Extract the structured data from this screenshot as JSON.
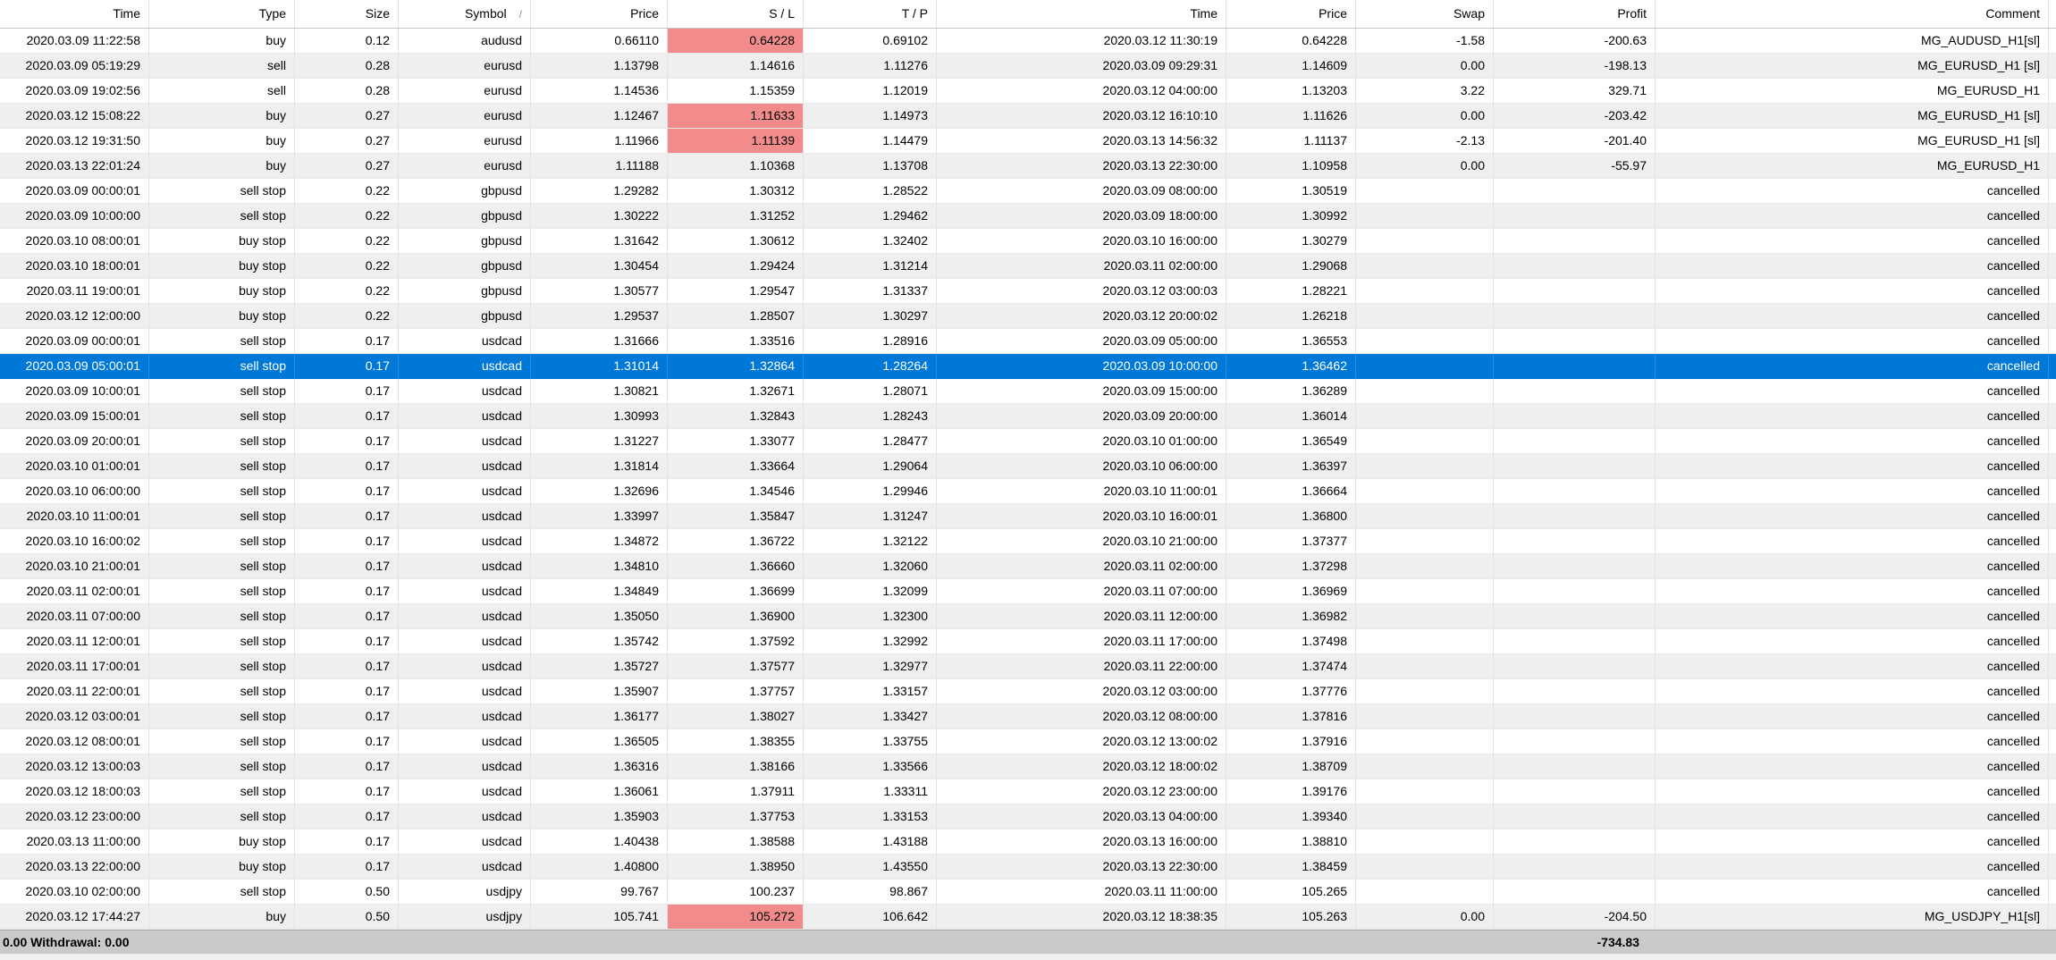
{
  "table": {
    "columns": [
      {
        "key": "time",
        "label": "Time"
      },
      {
        "key": "type",
        "label": "Type"
      },
      {
        "key": "size",
        "label": "Size"
      },
      {
        "key": "symbol",
        "label": "Symbol",
        "sort_icon": "/"
      },
      {
        "key": "price",
        "label": "Price"
      },
      {
        "key": "sl",
        "label": "S / L"
      },
      {
        "key": "tp",
        "label": "T / P"
      },
      {
        "key": "ctime",
        "label": "Time"
      },
      {
        "key": "cprice",
        "label": "Price"
      },
      {
        "key": "swap",
        "label": "Swap"
      },
      {
        "key": "profit",
        "label": "Profit"
      },
      {
        "key": "comment",
        "label": "Comment"
      }
    ],
    "rows": [
      {
        "time": "2020.03.09 11:22:58",
        "type": "buy",
        "size": "0.12",
        "symbol": "audusd",
        "price": "0.66110",
        "sl": "0.64228",
        "sl_hit": true,
        "tp": "0.69102",
        "ctime": "2020.03.12 11:30:19",
        "cprice": "0.64228",
        "swap": "-1.58",
        "profit": "-200.63",
        "comment": "MG_AUDUSD_H1[sl]"
      },
      {
        "time": "2020.03.09 05:19:29",
        "type": "sell",
        "size": "0.28",
        "symbol": "eurusd",
        "price": "1.13798",
        "sl": "1.14616",
        "tp": "1.11276",
        "ctime": "2020.03.09 09:29:31",
        "cprice": "1.14609",
        "swap": "0.00",
        "profit": "-198.13",
        "comment": "MG_EURUSD_H1 [sl]"
      },
      {
        "time": "2020.03.09 19:02:56",
        "type": "sell",
        "size": "0.28",
        "symbol": "eurusd",
        "price": "1.14536",
        "sl": "1.15359",
        "tp": "1.12019",
        "ctime": "2020.03.12 04:00:00",
        "cprice": "1.13203",
        "swap": "3.22",
        "profit": "329.71",
        "comment": "MG_EURUSD_H1"
      },
      {
        "time": "2020.03.12 15:08:22",
        "type": "buy",
        "size": "0.27",
        "symbol": "eurusd",
        "price": "1.12467",
        "sl": "1.11633",
        "sl_hit": true,
        "tp": "1.14973",
        "ctime": "2020.03.12 16:10:10",
        "cprice": "1.11626",
        "swap": "0.00",
        "profit": "-203.42",
        "comment": "MG_EURUSD_H1 [sl]"
      },
      {
        "time": "2020.03.12 19:31:50",
        "type": "buy",
        "size": "0.27",
        "symbol": "eurusd",
        "price": "1.11966",
        "sl": "1.11139",
        "sl_hit": true,
        "tp": "1.14479",
        "ctime": "2020.03.13 14:56:32",
        "cprice": "1.11137",
        "swap": "-2.13",
        "profit": "-201.40",
        "comment": "MG_EURUSD_H1 [sl]"
      },
      {
        "time": "2020.03.13 22:01:24",
        "type": "buy",
        "size": "0.27",
        "symbol": "eurusd",
        "price": "1.11188",
        "sl": "1.10368",
        "tp": "1.13708",
        "ctime": "2020.03.13 22:30:00",
        "cprice": "1.10958",
        "swap": "0.00",
        "profit": "-55.97",
        "comment": "MG_EURUSD_H1"
      },
      {
        "time": "2020.03.09 00:00:01",
        "type": "sell stop",
        "size": "0.22",
        "symbol": "gbpusd",
        "price": "1.29282",
        "sl": "1.30312",
        "tp": "1.28522",
        "ctime": "2020.03.09 08:00:00",
        "cprice": "1.30519",
        "swap": "",
        "profit": "",
        "comment": "cancelled"
      },
      {
        "time": "2020.03.09 10:00:00",
        "type": "sell stop",
        "size": "0.22",
        "symbol": "gbpusd",
        "price": "1.30222",
        "sl": "1.31252",
        "tp": "1.29462",
        "ctime": "2020.03.09 18:00:00",
        "cprice": "1.30992",
        "swap": "",
        "profit": "",
        "comment": "cancelled"
      },
      {
        "time": "2020.03.10 08:00:01",
        "type": "buy stop",
        "size": "0.22",
        "symbol": "gbpusd",
        "price": "1.31642",
        "sl": "1.30612",
        "tp": "1.32402",
        "ctime": "2020.03.10 16:00:00",
        "cprice": "1.30279",
        "swap": "",
        "profit": "",
        "comment": "cancelled"
      },
      {
        "time": "2020.03.10 18:00:01",
        "type": "buy stop",
        "size": "0.22",
        "symbol": "gbpusd",
        "price": "1.30454",
        "sl": "1.29424",
        "tp": "1.31214",
        "ctime": "2020.03.11 02:00:00",
        "cprice": "1.29068",
        "swap": "",
        "profit": "",
        "comment": "cancelled"
      },
      {
        "time": "2020.03.11 19:00:01",
        "type": "buy stop",
        "size": "0.22",
        "symbol": "gbpusd",
        "price": "1.30577",
        "sl": "1.29547",
        "tp": "1.31337",
        "ctime": "2020.03.12 03:00:03",
        "cprice": "1.28221",
        "swap": "",
        "profit": "",
        "comment": "cancelled"
      },
      {
        "time": "2020.03.12 12:00:00",
        "type": "buy stop",
        "size": "0.22",
        "symbol": "gbpusd",
        "price": "1.29537",
        "sl": "1.28507",
        "tp": "1.30297",
        "ctime": "2020.03.12 20:00:02",
        "cprice": "1.26218",
        "swap": "",
        "profit": "",
        "comment": "cancelled"
      },
      {
        "time": "2020.03.09 00:00:01",
        "type": "sell stop",
        "size": "0.17",
        "symbol": "usdcad",
        "price": "1.31666",
        "sl": "1.33516",
        "tp": "1.28916",
        "ctime": "2020.03.09 05:00:00",
        "cprice": "1.36553",
        "swap": "",
        "profit": "",
        "comment": "cancelled"
      },
      {
        "time": "2020.03.09 05:00:01",
        "type": "sell stop",
        "size": "0.17",
        "symbol": "usdcad",
        "price": "1.31014",
        "sl": "1.32864",
        "tp": "1.28264",
        "ctime": "2020.03.09 10:00:00",
        "cprice": "1.36462",
        "swap": "",
        "profit": "",
        "comment": "cancelled",
        "selected": true
      },
      {
        "time": "2020.03.09 10:00:01",
        "type": "sell stop",
        "size": "0.17",
        "symbol": "usdcad",
        "price": "1.30821",
        "sl": "1.32671",
        "tp": "1.28071",
        "ctime": "2020.03.09 15:00:00",
        "cprice": "1.36289",
        "swap": "",
        "profit": "",
        "comment": "cancelled"
      },
      {
        "time": "2020.03.09 15:00:01",
        "type": "sell stop",
        "size": "0.17",
        "symbol": "usdcad",
        "price": "1.30993",
        "sl": "1.32843",
        "tp": "1.28243",
        "ctime": "2020.03.09 20:00:00",
        "cprice": "1.36014",
        "swap": "",
        "profit": "",
        "comment": "cancelled"
      },
      {
        "time": "2020.03.09 20:00:01",
        "type": "sell stop",
        "size": "0.17",
        "symbol": "usdcad",
        "price": "1.31227",
        "sl": "1.33077",
        "tp": "1.28477",
        "ctime": "2020.03.10 01:00:00",
        "cprice": "1.36549",
        "swap": "",
        "profit": "",
        "comment": "cancelled"
      },
      {
        "time": "2020.03.10 01:00:01",
        "type": "sell stop",
        "size": "0.17",
        "symbol": "usdcad",
        "price": "1.31814",
        "sl": "1.33664",
        "tp": "1.29064",
        "ctime": "2020.03.10 06:00:00",
        "cprice": "1.36397",
        "swap": "",
        "profit": "",
        "comment": "cancelled"
      },
      {
        "time": "2020.03.10 06:00:00",
        "type": "sell stop",
        "size": "0.17",
        "symbol": "usdcad",
        "price": "1.32696",
        "sl": "1.34546",
        "tp": "1.29946",
        "ctime": "2020.03.10 11:00:01",
        "cprice": "1.36664",
        "swap": "",
        "profit": "",
        "comment": "cancelled"
      },
      {
        "time": "2020.03.10 11:00:01",
        "type": "sell stop",
        "size": "0.17",
        "symbol": "usdcad",
        "price": "1.33997",
        "sl": "1.35847",
        "tp": "1.31247",
        "ctime": "2020.03.10 16:00:01",
        "cprice": "1.36800",
        "swap": "",
        "profit": "",
        "comment": "cancelled"
      },
      {
        "time": "2020.03.10 16:00:02",
        "type": "sell stop",
        "size": "0.17",
        "symbol": "usdcad",
        "price": "1.34872",
        "sl": "1.36722",
        "tp": "1.32122",
        "ctime": "2020.03.10 21:00:00",
        "cprice": "1.37377",
        "swap": "",
        "profit": "",
        "comment": "cancelled"
      },
      {
        "time": "2020.03.10 21:00:01",
        "type": "sell stop",
        "size": "0.17",
        "symbol": "usdcad",
        "price": "1.34810",
        "sl": "1.36660",
        "tp": "1.32060",
        "ctime": "2020.03.11 02:00:00",
        "cprice": "1.37298",
        "swap": "",
        "profit": "",
        "comment": "cancelled"
      },
      {
        "time": "2020.03.11 02:00:01",
        "type": "sell stop",
        "size": "0.17",
        "symbol": "usdcad",
        "price": "1.34849",
        "sl": "1.36699",
        "tp": "1.32099",
        "ctime": "2020.03.11 07:00:00",
        "cprice": "1.36969",
        "swap": "",
        "profit": "",
        "comment": "cancelled"
      },
      {
        "time": "2020.03.11 07:00:00",
        "type": "sell stop",
        "size": "0.17",
        "symbol": "usdcad",
        "price": "1.35050",
        "sl": "1.36900",
        "tp": "1.32300",
        "ctime": "2020.03.11 12:00:00",
        "cprice": "1.36982",
        "swap": "",
        "profit": "",
        "comment": "cancelled"
      },
      {
        "time": "2020.03.11 12:00:01",
        "type": "sell stop",
        "size": "0.17",
        "symbol": "usdcad",
        "price": "1.35742",
        "sl": "1.37592",
        "tp": "1.32992",
        "ctime": "2020.03.11 17:00:00",
        "cprice": "1.37498",
        "swap": "",
        "profit": "",
        "comment": "cancelled"
      },
      {
        "time": "2020.03.11 17:00:01",
        "type": "sell stop",
        "size": "0.17",
        "symbol": "usdcad",
        "price": "1.35727",
        "sl": "1.37577",
        "tp": "1.32977",
        "ctime": "2020.03.11 22:00:00",
        "cprice": "1.37474",
        "swap": "",
        "profit": "",
        "comment": "cancelled"
      },
      {
        "time": "2020.03.11 22:00:01",
        "type": "sell stop",
        "size": "0.17",
        "symbol": "usdcad",
        "price": "1.35907",
        "sl": "1.37757",
        "tp": "1.33157",
        "ctime": "2020.03.12 03:00:00",
        "cprice": "1.37776",
        "swap": "",
        "profit": "",
        "comment": "cancelled"
      },
      {
        "time": "2020.03.12 03:00:01",
        "type": "sell stop",
        "size": "0.17",
        "symbol": "usdcad",
        "price": "1.36177",
        "sl": "1.38027",
        "tp": "1.33427",
        "ctime": "2020.03.12 08:00:00",
        "cprice": "1.37816",
        "swap": "",
        "profit": "",
        "comment": "cancelled"
      },
      {
        "time": "2020.03.12 08:00:01",
        "type": "sell stop",
        "size": "0.17",
        "symbol": "usdcad",
        "price": "1.36505",
        "sl": "1.38355",
        "tp": "1.33755",
        "ctime": "2020.03.12 13:00:02",
        "cprice": "1.37916",
        "swap": "",
        "profit": "",
        "comment": "cancelled"
      },
      {
        "time": "2020.03.12 13:00:03",
        "type": "sell stop",
        "size": "0.17",
        "symbol": "usdcad",
        "price": "1.36316",
        "sl": "1.38166",
        "tp": "1.33566",
        "ctime": "2020.03.12 18:00:02",
        "cprice": "1.38709",
        "swap": "",
        "profit": "",
        "comment": "cancelled"
      },
      {
        "time": "2020.03.12 18:00:03",
        "type": "sell stop",
        "size": "0.17",
        "symbol": "usdcad",
        "price": "1.36061",
        "sl": "1.37911",
        "tp": "1.33311",
        "ctime": "2020.03.12 23:00:00",
        "cprice": "1.39176",
        "swap": "",
        "profit": "",
        "comment": "cancelled"
      },
      {
        "time": "2020.03.12 23:00:00",
        "type": "sell stop",
        "size": "0.17",
        "symbol": "usdcad",
        "price": "1.35903",
        "sl": "1.37753",
        "tp": "1.33153",
        "ctime": "2020.03.13 04:00:00",
        "cprice": "1.39340",
        "swap": "",
        "profit": "",
        "comment": "cancelled"
      },
      {
        "time": "2020.03.13 11:00:00",
        "type": "buy stop",
        "size": "0.17",
        "symbol": "usdcad",
        "price": "1.40438",
        "sl": "1.38588",
        "tp": "1.43188",
        "ctime": "2020.03.13 16:00:00",
        "cprice": "1.38810",
        "swap": "",
        "profit": "",
        "comment": "cancelled"
      },
      {
        "time": "2020.03.13 22:00:00",
        "type": "buy stop",
        "size": "0.17",
        "symbol": "usdcad",
        "price": "1.40800",
        "sl": "1.38950",
        "tp": "1.43550",
        "ctime": "2020.03.13 22:30:00",
        "cprice": "1.38459",
        "swap": "",
        "profit": "",
        "comment": "cancelled"
      },
      {
        "time": "2020.03.10 02:00:00",
        "type": "sell stop",
        "size": "0.50",
        "symbol": "usdjpy",
        "price": "99.767",
        "sl": "100.237",
        "tp": "98.867",
        "ctime": "2020.03.11 11:00:00",
        "cprice": "105.265",
        "swap": "",
        "profit": "",
        "comment": "cancelled"
      },
      {
        "time": "2020.03.12 17:44:27",
        "type": "buy",
        "size": "0.50",
        "symbol": "usdjpy",
        "price": "105.741",
        "sl": "105.272",
        "sl_hit": true,
        "tp": "106.642",
        "ctime": "2020.03.12 18:38:35",
        "cprice": "105.263",
        "swap": "0.00",
        "profit": "-204.50",
        "comment": "MG_USDJPY_H1[sl]"
      }
    ]
  },
  "footer": {
    "left_text": "0.00  Withdrawal: 0.00",
    "profit_total": "-734.83"
  },
  "colors": {
    "selection": "#0078d7",
    "sl_hit": "#f28c8c",
    "row_alt": "#efefef",
    "footer_bg": "#cacaca"
  }
}
